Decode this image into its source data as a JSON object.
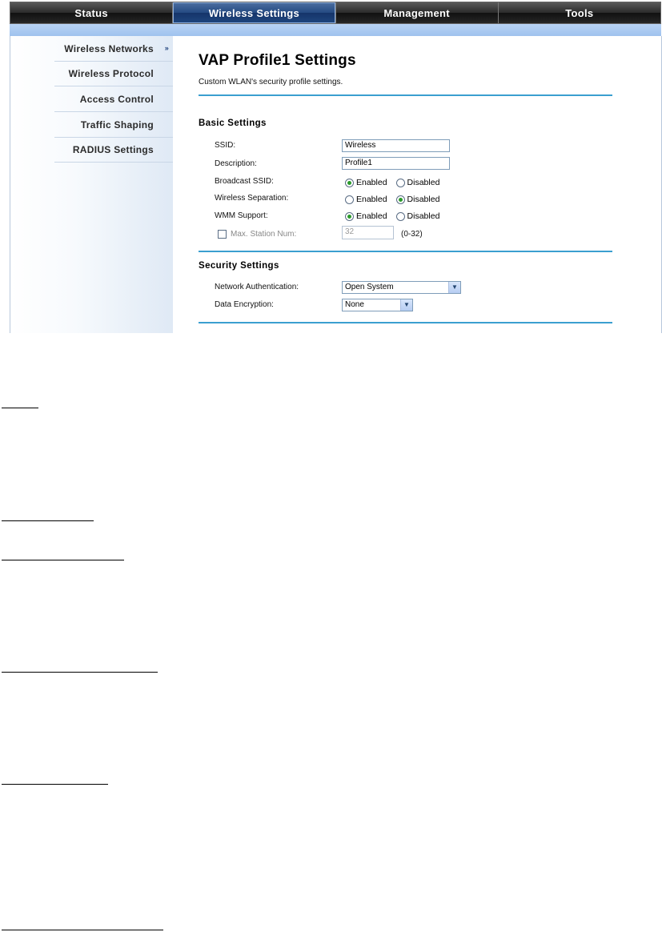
{
  "topnav": {
    "tabs": [
      {
        "label": "Status",
        "active": false
      },
      {
        "label": "Wireless Settings",
        "active": true
      },
      {
        "label": "Management",
        "active": false
      },
      {
        "label": "Tools",
        "active": false
      }
    ]
  },
  "sidebar": {
    "items": [
      {
        "label": "Wireless Networks",
        "active": true,
        "icon": "double-chevron-right-icon",
        "icon_glyph": "»"
      },
      {
        "label": "Wireless Protocol"
      },
      {
        "label": "Access Control"
      },
      {
        "label": "Traffic Shaping"
      },
      {
        "label": "RADIUS Settings"
      }
    ]
  },
  "main": {
    "title": "VAP Profile1 Settings",
    "description": "Custom WLAN's security profile settings.",
    "basic": {
      "heading": "Basic Settings",
      "ssid_label": "SSID:",
      "ssid_value": "Wireless",
      "desc_label": "Description:",
      "desc_value": "Profile1",
      "broadcast_label": "Broadcast SSID:",
      "separation_label": "Wireless Separation:",
      "wmm_label": "WMM Support:",
      "enabled": "Enabled",
      "disabled": "Disabled",
      "broadcast_selected": "Enabled",
      "separation_selected": "Disabled",
      "wmm_selected": "Enabled",
      "max_station_label": "Max. Station Num:",
      "max_station_value": "32",
      "max_station_range": "(0-32)",
      "max_station_checked": false
    },
    "security": {
      "heading": "Security Settings",
      "auth_label": "Network Authentication:",
      "auth_value": "Open System",
      "enc_label": "Data Encryption:",
      "enc_value": "None"
    }
  },
  "colors": {
    "accent_line": "#3b9fd0",
    "active_tab": "#244a82",
    "radio_dot": "#2a9a2a"
  }
}
